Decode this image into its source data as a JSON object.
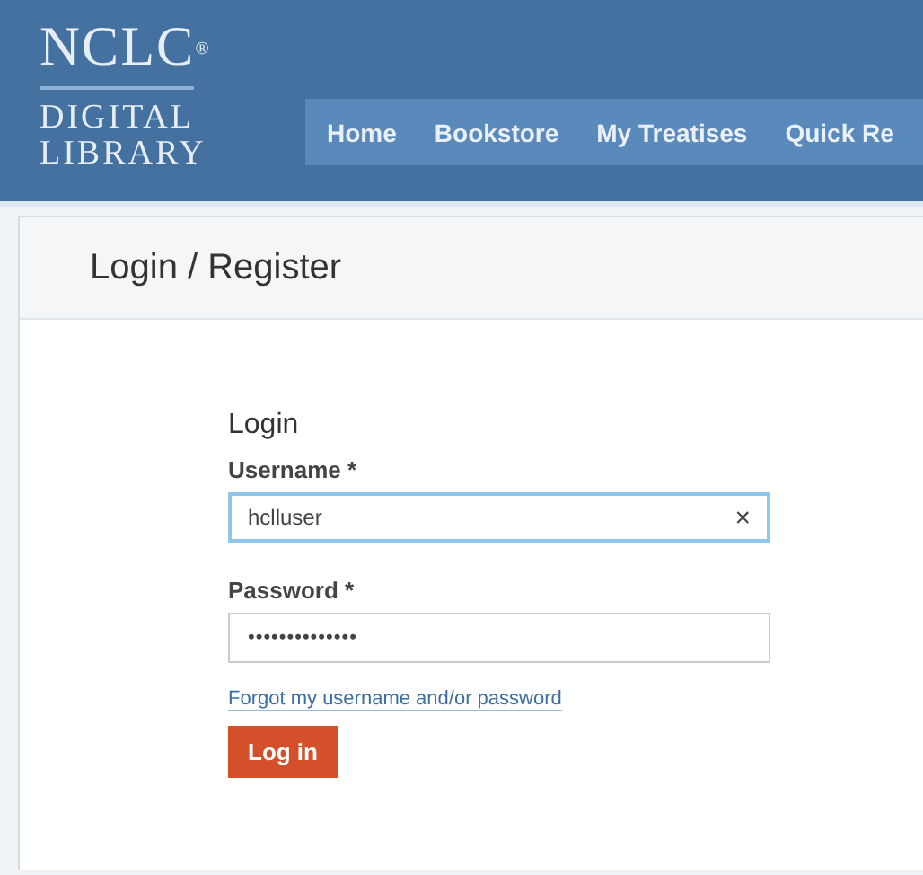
{
  "logo": {
    "mark": "NCLC$^{®}$",
    "line_1": "DIGITAL",
    "line_2": "LIBRARY"
  },
  "nav": [
    {
      "label": "Home"
    },
    {
      "label": "Bookstore"
    },
    {
      "label": "My Treatises"
    },
    {
      "label": "Quick Re"
    }
  ],
  "page_title": "Login / Register",
  "form": {
    "heading": "Login",
    "username": {
      "label": "Username *",
      "value": "hclluser",
      "focused": true,
      "clear": "×"
    },
    "password": {
      "label": "Password *",
      "value": "••••••••••••••"
    },
    "forgot_link": "Forgot my username and/or password",
    "submit": "Log in"
  }
}
